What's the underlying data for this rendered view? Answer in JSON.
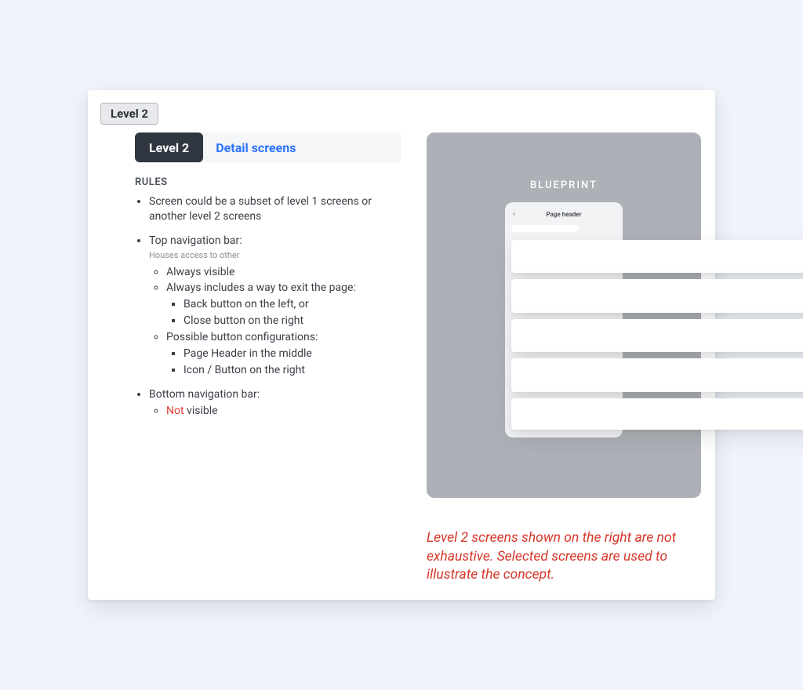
{
  "badge": {
    "label": "Level 2"
  },
  "tabs": {
    "active": "Level 2",
    "inactive": "Detail screens"
  },
  "rules": {
    "heading": "RULES",
    "item1": "Screen could be a subset of level 1 screens or another level 2 screens",
    "item2": {
      "title": "Top navigation bar:",
      "subnote": "Houses access to other",
      "a": "Always visible",
      "b": {
        "title": "Always includes a way to exit the page:",
        "i": "Back button on the left, or",
        "ii": "Close button on the right"
      },
      "c": {
        "title": "Possible button configurations:",
        "i": "Page Header in the middle",
        "ii": "Icon / Button on the right"
      }
    },
    "item3": {
      "title": "Bottom navigation bar:",
      "a_prefix": "Not",
      "a_suffix": " visible"
    }
  },
  "blueprint": {
    "title": "BLUEPRINT",
    "phone_header": "Page header",
    "back_glyph": "‹"
  },
  "footnote": "Level 2 screens shown on the right are not exhaustive. Selected screens are used to illustrate the concept."
}
